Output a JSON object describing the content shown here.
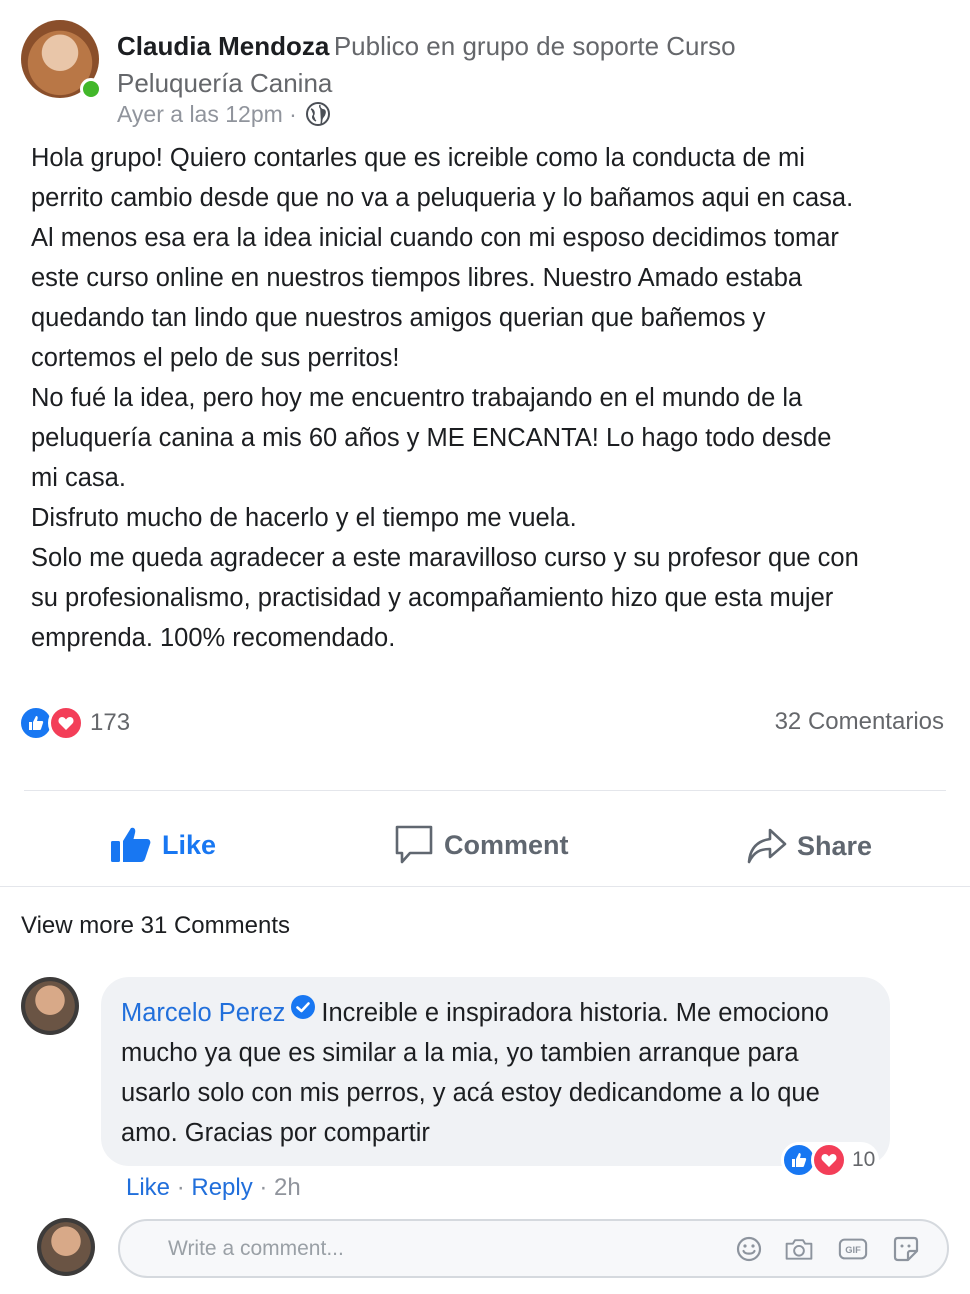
{
  "post": {
    "author": "Claudia Mendoza",
    "group_line1": "Publico en grupo de soporte Curso",
    "group_line2": "Peluquería Canina",
    "timestamp": "Ayer a las 12pm ·",
    "privacy_icon": "globe-icon",
    "body": "Hola grupo! Quiero contarles que es icreible como la conducta de mi\nperrito cambio desde que no va a peluqueria y lo bañamos aqui en casa.\nAl menos esa era la idea inicial cuando con mi esposo decidimos tomar\neste curso online en nuestros tiempos libres. Nuestro Amado estaba\nquedando tan lindo que nuestros amigos querian que bañemos y\ncortemos el pelo de sus perritos!\nNo fué la idea, pero hoy me encuentro trabajando en el mundo de la\npeluquería canina a mis 60 años y ME ENCANTA! Lo hago todo desde\nmi casa.\nDisfruto mucho de hacerlo y el tiempo me vuela.\nSolo me queda agradecer a este maravilloso curso y su profesor que con\nsu profesionalismo, practisidad y acompañamiento hizo que esta mujer\nemprenda. 100% recomendado.",
    "reaction_count": "173",
    "comments_count": "32 Comentarios"
  },
  "actions": {
    "like": "Like",
    "comment": "Comment",
    "share": "Share"
  },
  "comments": {
    "view_more": "View more 31 Comments",
    "items": [
      {
        "author": "Marcelo Perez",
        "text": "Increible e inspiradora historia. Me emociono mucho ya que es similar a la mia, yo tambien arranque para usarlo solo con mis perros, y acá estoy dedicandome a lo que amo. Gracias por compartir",
        "reaction_count": "10",
        "like_label": "Like",
        "reply_label": "Reply",
        "time": "2h"
      }
    ]
  },
  "composer": {
    "placeholder": "Write a comment..."
  },
  "colors": {
    "accent": "#1877f2",
    "love": "#f33e58",
    "online": "#42b72a"
  }
}
